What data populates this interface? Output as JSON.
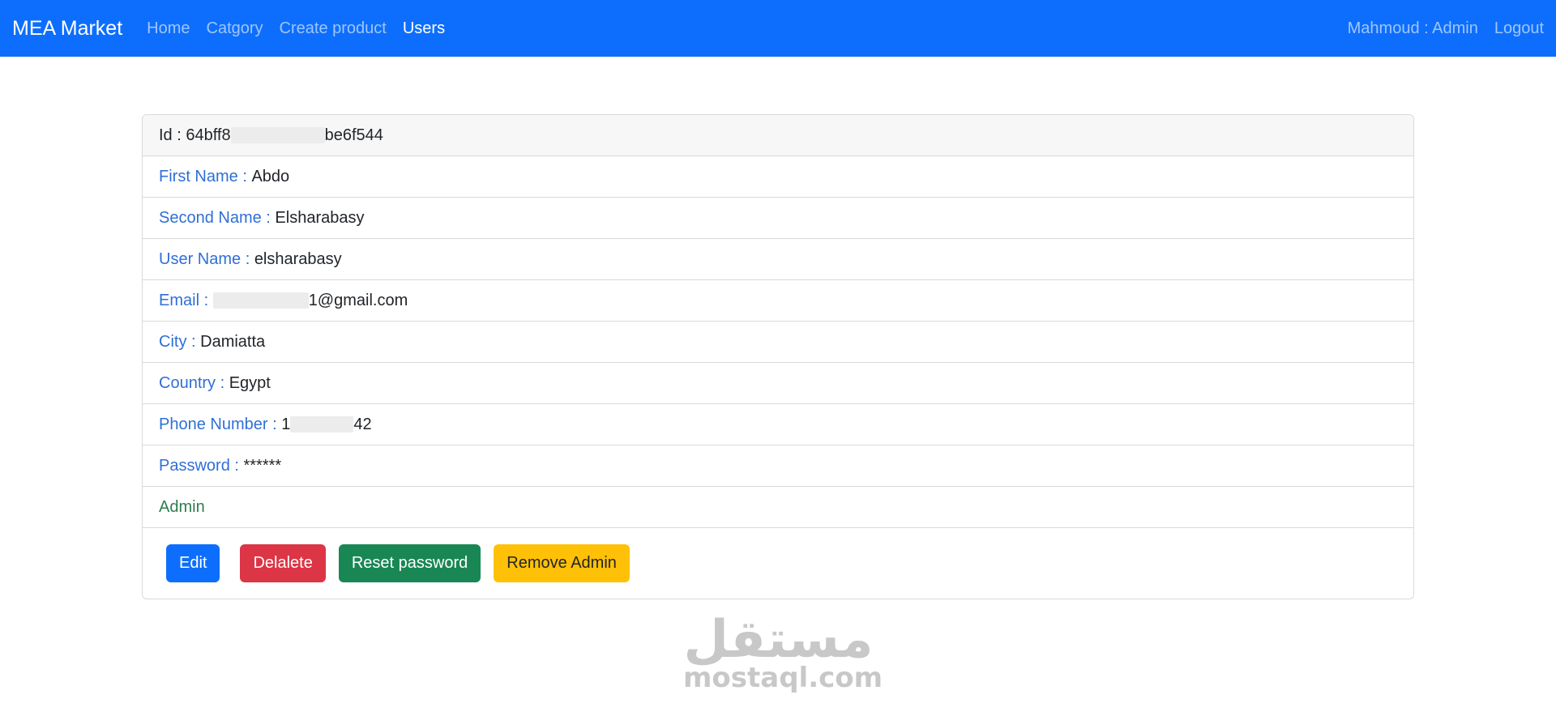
{
  "navbar": {
    "brand": "MEA Market",
    "links": [
      {
        "label": "Home"
      },
      {
        "label": "Catgory"
      },
      {
        "label": "Create product"
      },
      {
        "label": "Users"
      }
    ],
    "user_label": "Mahmoud : Admin",
    "logout_label": "Logout"
  },
  "card": {
    "id_label": "Id : ",
    "id_prefix": "64bff8",
    "id_suffix": "be6f544",
    "fields": {
      "first_name": {
        "label": "First Name",
        "sep": " : ",
        "value": "Abdo"
      },
      "second_name": {
        "label": "Second Name",
        "sep": " : ",
        "value": "Elsharabasy"
      },
      "user_name": {
        "label": "User Name",
        "sep": " : ",
        "value": "elsharabasy"
      },
      "email": {
        "label": "Email",
        "sep": " : ",
        "value_suffix": "1@gmail.com"
      },
      "city": {
        "label": "City",
        "sep": " : ",
        "value": "Damiatta"
      },
      "country": {
        "label": "Country",
        "sep": " : ",
        "value": "Egypt"
      },
      "phone": {
        "label": "Phone Number",
        "sep": " : ",
        "value_prefix": "1",
        "value_suffix": "42"
      },
      "password": {
        "label": "Password",
        "sep": " : ",
        "value": "******"
      }
    },
    "role": "Admin",
    "buttons": {
      "edit": "Edit",
      "delete": "Delalete",
      "reset_password": "Reset password",
      "remove_admin": "Remove Admin"
    }
  },
  "watermark": {
    "arabic": "مستقل",
    "latin": "mostaql.com"
  },
  "colors": {
    "navbar": "#0d6efd",
    "label": "#2f6fd6",
    "admin": "#2e7d4f",
    "danger": "#dc3545",
    "success": "#198754",
    "warning": "#ffc107"
  }
}
